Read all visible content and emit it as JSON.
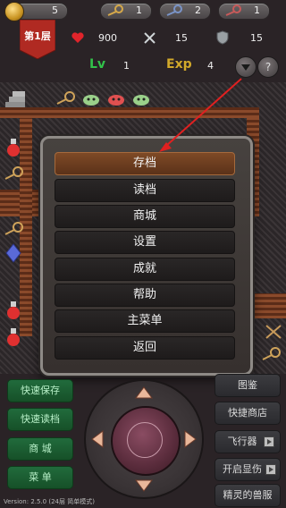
{
  "topbar": {
    "gold": "5",
    "key_yellow": "1",
    "key_blue": "2",
    "key_red": "1"
  },
  "floor_badge": "第1层",
  "stats": {
    "hp": "900",
    "atk": "15",
    "def": "15",
    "lv_label": "Lv",
    "lv": "1",
    "exp_label": "Exp",
    "exp": "4",
    "help_label": "?"
  },
  "menu": {
    "items": [
      {
        "label": "存档",
        "active": true
      },
      {
        "label": "读档"
      },
      {
        "label": "商城"
      },
      {
        "label": "设置"
      },
      {
        "label": "成就"
      },
      {
        "label": "帮助"
      },
      {
        "label": "主菜单"
      },
      {
        "label": "返回"
      }
    ]
  },
  "left_buttons": [
    "快速保存",
    "快速读档",
    "商 城",
    "菜 单"
  ],
  "right_buttons": [
    "图鉴",
    "快捷商店",
    "飞行器",
    "开启显伤",
    "精灵的兽服"
  ],
  "version": "Version: 2.5.0 (24层 简单模式)",
  "colors": {
    "accent_active": "#7e4a26",
    "wall": "#8a4a2b",
    "green_button": "#216b3c",
    "arrow": "#e02020"
  }
}
